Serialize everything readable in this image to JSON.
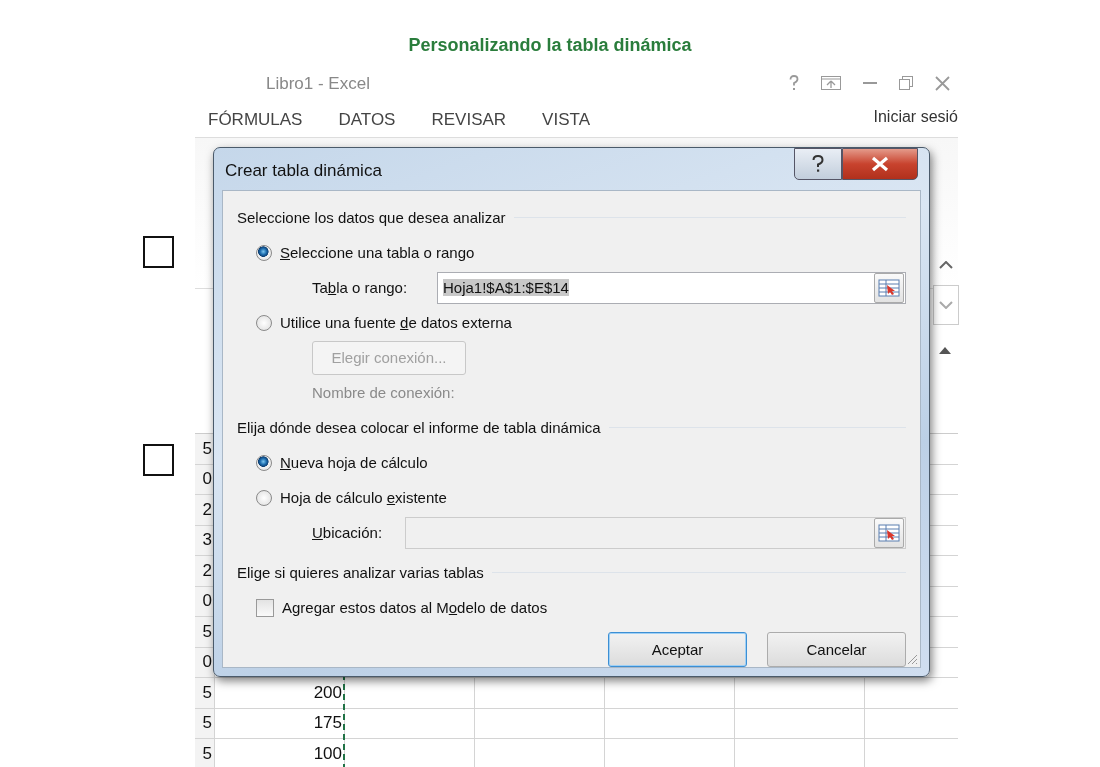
{
  "page_title": "Personalizando la tabla dinámica",
  "checkboxes": [
    {
      "checked": false
    },
    {
      "checked": false
    }
  ],
  "excel": {
    "title": "Libro1 - Excel",
    "ribbon_tabs": [
      "FÓRMULAS",
      "DATOS",
      "REVISAR",
      "VISTA"
    ],
    "account": "Iniciar sesió",
    "sheet_rows": [
      {
        "column_1": "5"
      },
      {
        "column_1": "0"
      },
      {
        "column_1": "2"
      },
      {
        "column_1": "3"
      },
      {
        "column_1": "2"
      },
      {
        "column_1": "0"
      },
      {
        "column_1": "5"
      },
      {
        "column_1": "0"
      },
      {
        "column_1": "5",
        "column_2": "200"
      },
      {
        "column_1": "5",
        "column_2": "175"
      },
      {
        "column_1": "5",
        "column_2": "100"
      }
    ]
  },
  "dialog": {
    "title": "Crear tabla dinámica",
    "source_heading": "Seleccione los datos que desea analizar",
    "source_options": [
      {
        "label": {
          "key": "S",
          "post": "eleccione una tabla o rango"
        },
        "selected": true
      },
      {
        "label": {
          "pre": "Utilice una fuente ",
          "key": "d",
          "post": "e datos externa"
        },
        "selected": false
      }
    ],
    "range_field": {
      "label": {
        "pre": "Ta",
        "key": "b",
        "post": "la o rango:"
      },
      "value": "Hoja1!$A$1:$E$14",
      "highlighted": true
    },
    "connection_button": {
      "label": "Elegir conexión...",
      "disabled": true
    },
    "connection_name": {
      "label": "Nombre de conexión:",
      "disabled": true
    },
    "location_heading": "Elija dónde desea colocar el informe de tabla dinámica",
    "location_options": [
      {
        "label": {
          "key": "N",
          "post": "ueva hoja de cálculo"
        },
        "selected": true
      },
      {
        "label": {
          "pre": "Hoja de cálculo ",
          "key": "e",
          "post": "xistente"
        },
        "selected": false
      }
    ],
    "location_field": {
      "label": {
        "key": "U",
        "post": "bicación:"
      },
      "disabled": true
    },
    "tables_heading": "Elige si quieres analizar varias tablas",
    "data_model": {
      "label": {
        "pre": "Agregar estos datos al M",
        "key": "o",
        "post": "delo de datos"
      },
      "checked": false
    },
    "buttons": [
      {
        "label": "Aceptar",
        "default": true
      },
      {
        "label": "Cancelar",
        "default": false
      }
    ]
  }
}
